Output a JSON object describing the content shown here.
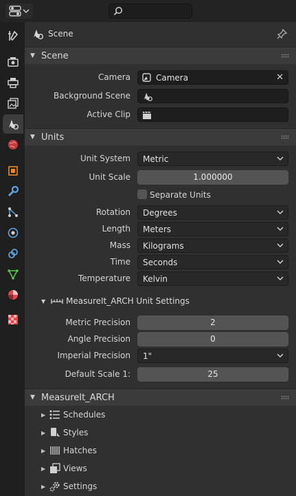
{
  "context": {
    "title": "Scene"
  },
  "sections": {
    "scene": {
      "title": "Scene",
      "camera_label": "Camera",
      "camera_value": "Camera",
      "background_scene_label": "Background Scene",
      "active_clip_label": "Active Clip"
    },
    "units": {
      "title": "Units",
      "unit_system_label": "Unit System",
      "unit_system_value": "Metric",
      "unit_scale_label": "Unit Scale",
      "unit_scale_value": "1.000000",
      "separate_units_label": "Separate Units",
      "rotation_label": "Rotation",
      "rotation_value": "Degrees",
      "length_label": "Length",
      "length_value": "Meters",
      "mass_label": "Mass",
      "mass_value": "Kilograms",
      "time_label": "Time",
      "time_value": "Seconds",
      "temperature_label": "Temperature",
      "temperature_value": "Kelvin",
      "measureit": {
        "title": "MeasureIt_ARCH Unit Settings",
        "metric_precision_label": "Metric Precision",
        "metric_precision_value": "2",
        "angle_precision_label": "Angle Precision",
        "angle_precision_value": "0",
        "imperial_precision_label": "Imperial Precision",
        "imperial_precision_value": "1\"",
        "default_scale_label": "Default Scale 1:",
        "default_scale_value": "25"
      }
    },
    "measureit_arch": {
      "title": "MeasureIt_ARCH",
      "items": [
        "Schedules",
        "Styles",
        "Hatches",
        "Views",
        "Settings"
      ]
    }
  },
  "icons": {
    "sidebar": [
      "tool-icon",
      "render-icon",
      "output-icon",
      "view-layer-icon",
      "scene-icon",
      "world-icon",
      "object-icon",
      "modifier-icon",
      "particles-icon",
      "physics-icon",
      "constraints-icon",
      "data-icon",
      "material-icon",
      "texture-icon"
    ]
  },
  "colors": {
    "accent_orange": "#e8872b",
    "accent_blue": "#5fa2dd",
    "accent_green": "#59c74d",
    "accent_red": "#e0474c"
  }
}
